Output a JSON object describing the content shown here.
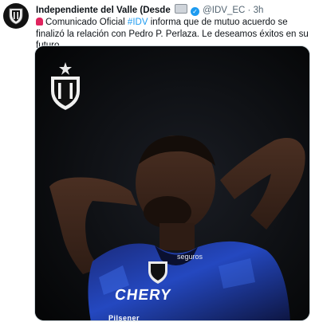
{
  "tweet": {
    "author_name": "Independiente del Valle (Desde",
    "handle": "@IDV_EC",
    "separator": "·",
    "time": "3h",
    "text_intro": "Comunicado Oficial",
    "hashtag": "#IDV",
    "text_rest": " informa que de mutuo acuerdo se finalizó la relación con Pedro P. Perlaza. Le deseamos éxitos en su futuro.",
    "icons": {
      "avatar": "club-crest-icon",
      "verified": "verified-badge-icon",
      "alert": "rotating-light-icon"
    }
  },
  "media": {
    "jersey_sponsor": "CHERY",
    "sleeve_sponsor": "seguros",
    "chest_partial_text": "Pilsener"
  },
  "colors": {
    "link": "#1d9bf0",
    "text": "#0f1419",
    "muted": "#536471",
    "jersey_blue": "#1c3fa8",
    "jersey_navy": "#0d1540"
  }
}
